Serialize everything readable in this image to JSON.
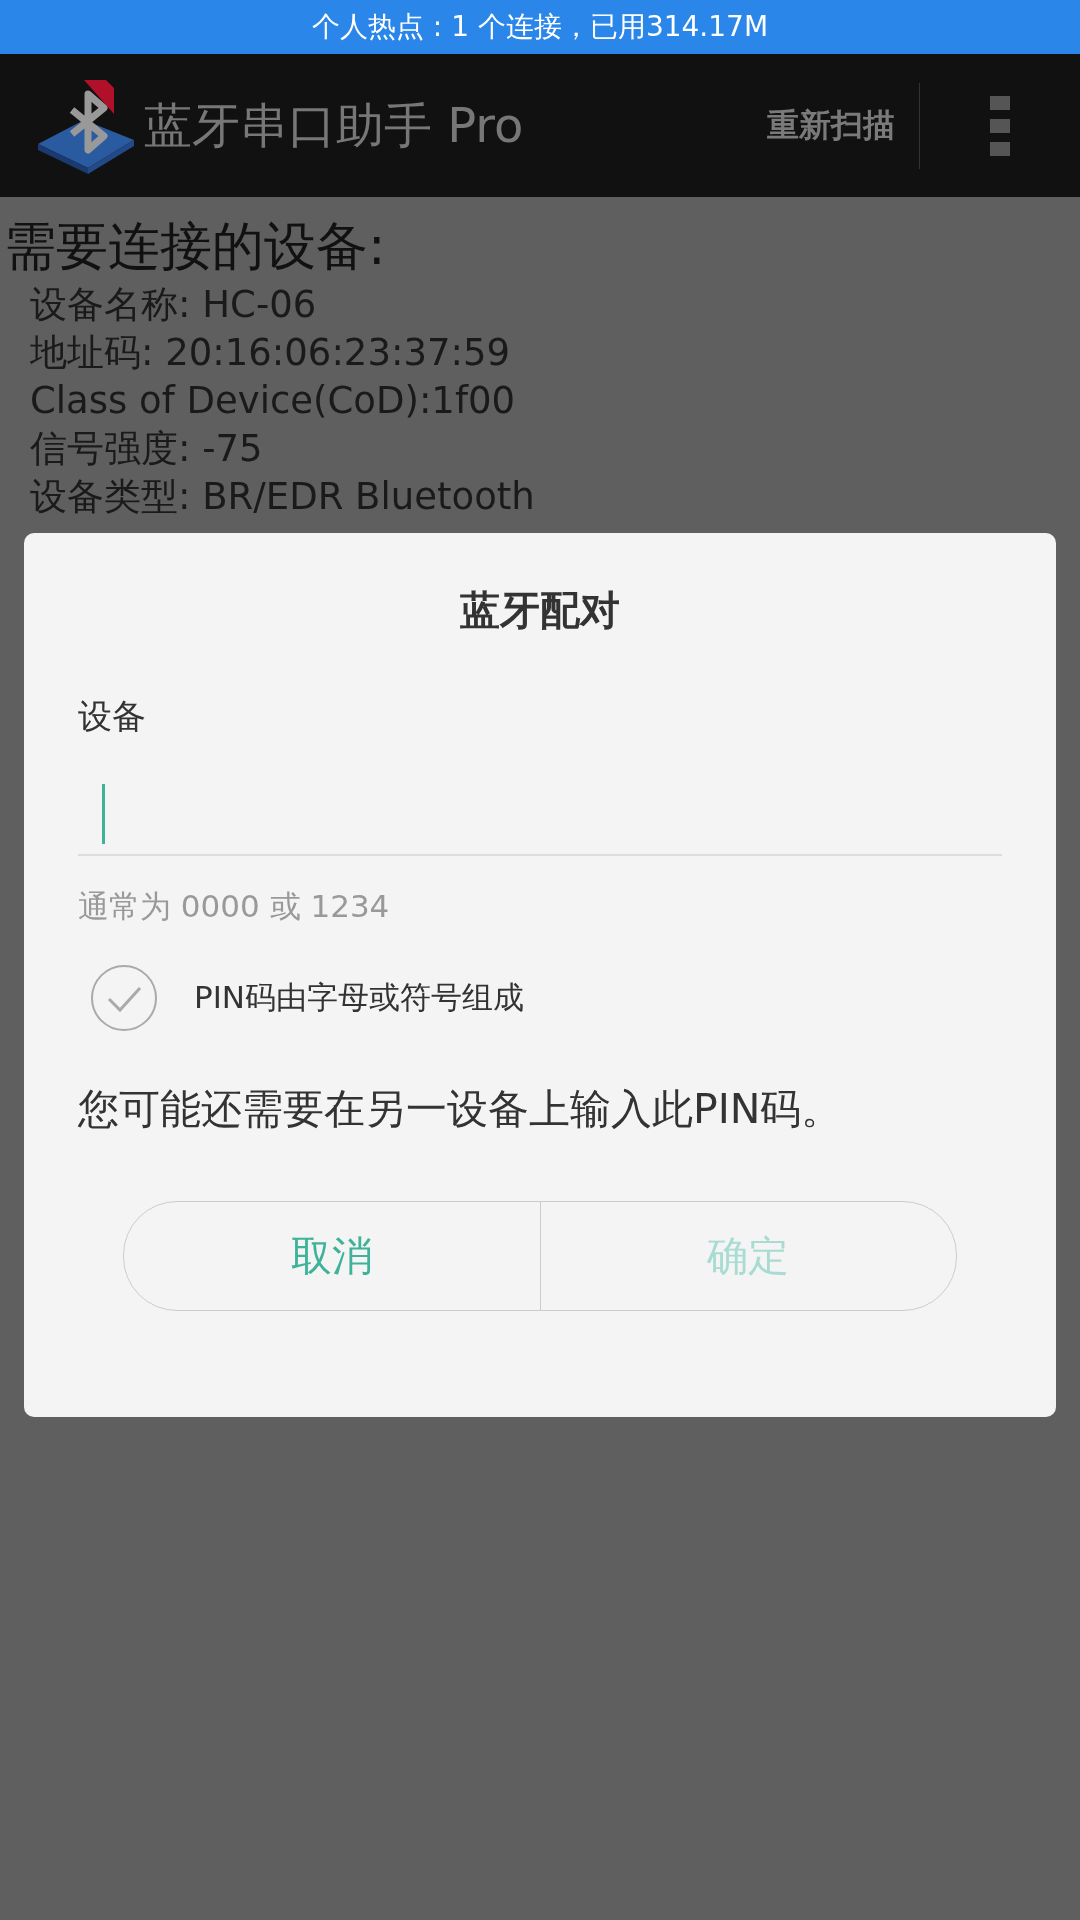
{
  "status_bar": {
    "text": "个人热点 : 1 个连接，已用314.17M"
  },
  "app_bar": {
    "title": "蓝牙串口助手 Pro",
    "action": "重新扫描"
  },
  "content": {
    "heading": "需要连接的设备:",
    "details": [
      {
        "text": "设备名称: HC-06"
      },
      {
        "text": "地址码: 20:16:06:23:37:59"
      },
      {
        "text": "Class of Device(CoD):1f00"
      },
      {
        "text": "信号强度: -75"
      },
      {
        "text": "设备类型: BR/EDR Bluetooth"
      }
    ]
  },
  "dialog": {
    "title": "蓝牙配对",
    "device_label": "设备",
    "pin_field": {
      "focused": true
    },
    "hint": "通常为 0000 或 1234",
    "checkbox": {
      "label": "PIN码由字母或符号组成",
      "checked": false
    },
    "message": "您可能还需要在另一设备上输入此PIN码。",
    "buttons": [
      {
        "label": "取消",
        "disabled": false
      },
      {
        "label": "确定",
        "disabled": true
      }
    ]
  }
}
